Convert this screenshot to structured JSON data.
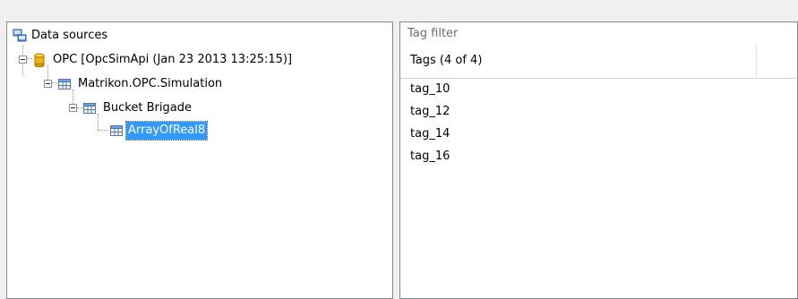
{
  "tree": {
    "nodes": [
      {
        "id": "root",
        "label": "Data sources",
        "icon": "datasources-icon"
      },
      {
        "id": "opc",
        "label": "OPC [OpcSimApi (Jan 23 2013 13:25:15)]",
        "icon": "database-icon"
      },
      {
        "id": "matrikon",
        "label": "Matrikon.OPC.Simulation",
        "icon": "table-icon"
      },
      {
        "id": "bucket",
        "label": "Bucket Brigade",
        "icon": "table-icon"
      },
      {
        "id": "array",
        "label": "ArrayOfReal8",
        "icon": "table-icon",
        "selected": true
      }
    ]
  },
  "tags": {
    "filter_placeholder": "Tag filter",
    "filter_value": "",
    "header": "Tags (4 of 4)",
    "items": [
      "tag_10",
      "tag_12",
      "tag_14",
      "tag_16"
    ]
  },
  "colors": {
    "selection": "#3399ff",
    "border": "#828790",
    "background": "#f0f0f0"
  }
}
